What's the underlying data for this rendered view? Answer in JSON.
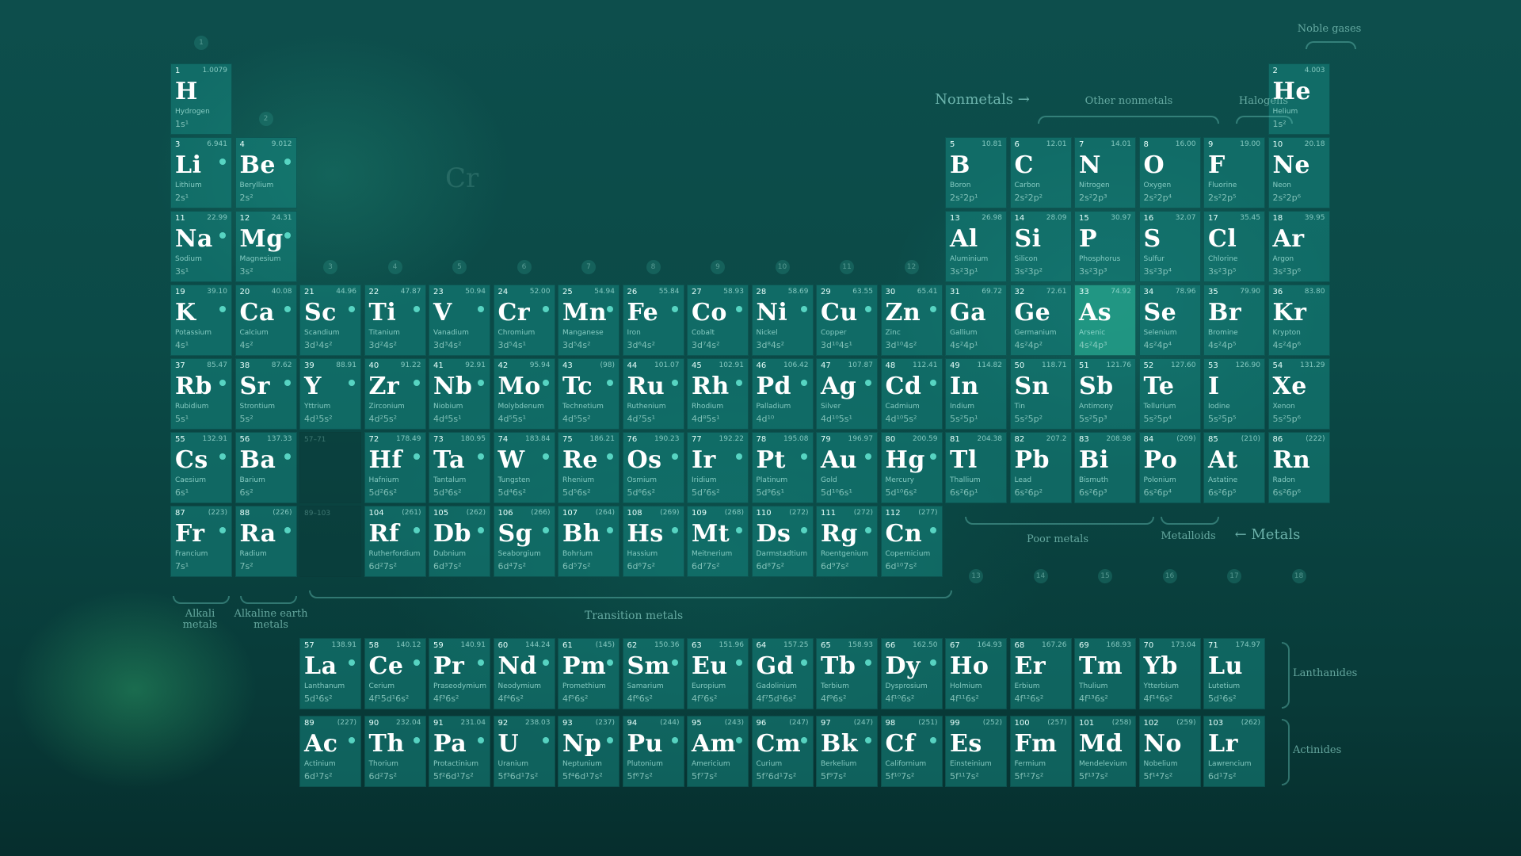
{
  "labels": {
    "noble_gases": "Noble gases",
    "nonmetals": "Nonmetals →",
    "other_nonmetals": "Other nonmetals",
    "halogens": "Halogens",
    "poor_metals": "Poor metals",
    "metalloids": "Metalloids",
    "metals": "← Metals",
    "alkali_metals": "Alkali\nmetals",
    "alkaline_earth_metals": "Alkaline earth\nmetals",
    "transition_metals": "Transition metals",
    "lanthanides": "Lanthanides",
    "actinides": "Actinides",
    "placeholder_57_71": "57–71",
    "placeholder_89_103": "89–103"
  },
  "group_numbers": [
    "1",
    "2",
    "3",
    "4",
    "5",
    "6",
    "7",
    "8",
    "9",
    "10",
    "11",
    "12",
    "13",
    "14",
    "15",
    "16",
    "17",
    "18"
  ],
  "elements": [
    {
      "n": "1",
      "m": "1.0079",
      "s": "H",
      "name": "Hydrogen",
      "c": "1s¹",
      "r": 1,
      "col": 1
    },
    {
      "n": "2",
      "m": "4.003",
      "s": "He",
      "name": "Helium",
      "c": "1s²",
      "r": 1,
      "col": 18
    },
    {
      "n": "3",
      "m": "6.941",
      "s": "Li",
      "name": "Lithium",
      "c": "2s¹",
      "r": 2,
      "col": 1
    },
    {
      "n": "4",
      "m": "9.012",
      "s": "Be",
      "name": "Beryllium",
      "c": "2s²",
      "r": 2,
      "col": 2
    },
    {
      "n": "5",
      "m": "10.81",
      "s": "B",
      "name": "Boron",
      "c": "2s²2p¹",
      "r": 2,
      "col": 13
    },
    {
      "n": "6",
      "m": "12.01",
      "s": "C",
      "name": "Carbon",
      "c": "2s²2p²",
      "r": 2,
      "col": 14
    },
    {
      "n": "7",
      "m": "14.01",
      "s": "N",
      "name": "Nitrogen",
      "c": "2s²2p³",
      "r": 2,
      "col": 15
    },
    {
      "n": "8",
      "m": "16.00",
      "s": "O",
      "name": "Oxygen",
      "c": "2s²2p⁴",
      "r": 2,
      "col": 16
    },
    {
      "n": "9",
      "m": "19.00",
      "s": "F",
      "name": "Fluorine",
      "c": "2s²2p⁵",
      "r": 2,
      "col": 17
    },
    {
      "n": "10",
      "m": "20.18",
      "s": "Ne",
      "name": "Neon",
      "c": "2s²2p⁶",
      "r": 2,
      "col": 18
    },
    {
      "n": "11",
      "m": "22.99",
      "s": "Na",
      "name": "Sodium",
      "c": "3s¹",
      "r": 3,
      "col": 1
    },
    {
      "n": "12",
      "m": "24.31",
      "s": "Mg",
      "name": "Magnesium",
      "c": "3s²",
      "r": 3,
      "col": 2
    },
    {
      "n": "13",
      "m": "26.98",
      "s": "Al",
      "name": "Aluminium",
      "c": "3s²3p¹",
      "r": 3,
      "col": 13
    },
    {
      "n": "14",
      "m": "28.09",
      "s": "Si",
      "name": "Silicon",
      "c": "3s²3p²",
      "r": 3,
      "col": 14
    },
    {
      "n": "15",
      "m": "30.97",
      "s": "P",
      "name": "Phosphorus",
      "c": "3s²3p³",
      "r": 3,
      "col": 15
    },
    {
      "n": "16",
      "m": "32.07",
      "s": "S",
      "name": "Sulfur",
      "c": "3s²3p⁴",
      "r": 3,
      "col": 16
    },
    {
      "n": "17",
      "m": "35.45",
      "s": "Cl",
      "name": "Chlorine",
      "c": "3s²3p⁵",
      "r": 3,
      "col": 17
    },
    {
      "n": "18",
      "m": "39.95",
      "s": "Ar",
      "name": "Argon",
      "c": "3s²3p⁶",
      "r": 3,
      "col": 18
    },
    {
      "n": "19",
      "m": "39.10",
      "s": "K",
      "name": "Potassium",
      "c": "4s¹",
      "r": 4,
      "col": 1
    },
    {
      "n": "20",
      "m": "40.08",
      "s": "Ca",
      "name": "Calcium",
      "c": "4s²",
      "r": 4,
      "col": 2
    },
    {
      "n": "21",
      "m": "44.96",
      "s": "Sc",
      "name": "Scandium",
      "c": "3d¹4s²",
      "r": 4,
      "col": 3
    },
    {
      "n": "22",
      "m": "47.87",
      "s": "Ti",
      "name": "Titanium",
      "c": "3d²4s²",
      "r": 4,
      "col": 4
    },
    {
      "n": "23",
      "m": "50.94",
      "s": "V",
      "name": "Vanadium",
      "c": "3d³4s²",
      "r": 4,
      "col": 5
    },
    {
      "n": "24",
      "m": "52.00",
      "s": "Cr",
      "name": "Chromium",
      "c": "3d⁵4s¹",
      "r": 4,
      "col": 6
    },
    {
      "n": "25",
      "m": "54.94",
      "s": "Mn",
      "name": "Manganese",
      "c": "3d⁵4s²",
      "r": 4,
      "col": 7
    },
    {
      "n": "26",
      "m": "55.84",
      "s": "Fe",
      "name": "Iron",
      "c": "3d⁶4s²",
      "r": 4,
      "col": 8
    },
    {
      "n": "27",
      "m": "58.93",
      "s": "Co",
      "name": "Cobalt",
      "c": "3d⁷4s²",
      "r": 4,
      "col": 9
    },
    {
      "n": "28",
      "m": "58.69",
      "s": "Ni",
      "name": "Nickel",
      "c": "3d⁸4s²",
      "r": 4,
      "col": 10
    },
    {
      "n": "29",
      "m": "63.55",
      "s": "Cu",
      "name": "Copper",
      "c": "3d¹⁰4s¹",
      "r": 4,
      "col": 11
    },
    {
      "n": "30",
      "m": "65.41",
      "s": "Zn",
      "name": "Zinc",
      "c": "3d¹⁰4s²",
      "r": 4,
      "col": 12
    },
    {
      "n": "31",
      "m": "69.72",
      "s": "Ga",
      "name": "Gallium",
      "c": "4s²4p¹",
      "r": 4,
      "col": 13
    },
    {
      "n": "32",
      "m": "72.61",
      "s": "Ge",
      "name": "Germanium",
      "c": "4s²4p²",
      "r": 4,
      "col": 14
    },
    {
      "n": "33",
      "m": "74.92",
      "s": "As",
      "name": "Arsenic",
      "c": "4s²4p³",
      "r": 4,
      "col": 15,
      "hi": true
    },
    {
      "n": "34",
      "m": "78.96",
      "s": "Se",
      "name": "Selenium",
      "c": "4s²4p⁴",
      "r": 4,
      "col": 16
    },
    {
      "n": "35",
      "m": "79.90",
      "s": "Br",
      "name": "Bromine",
      "c": "4s²4p⁵",
      "r": 4,
      "col": 17
    },
    {
      "n": "36",
      "m": "83.80",
      "s": "Kr",
      "name": "Krypton",
      "c": "4s²4p⁶",
      "r": 4,
      "col": 18
    },
    {
      "n": "37",
      "m": "85.47",
      "s": "Rb",
      "name": "Rubidium",
      "c": "5s¹",
      "r": 5,
      "col": 1
    },
    {
      "n": "38",
      "m": "87.62",
      "s": "Sr",
      "name": "Strontium",
      "c": "5s²",
      "r": 5,
      "col": 2
    },
    {
      "n": "39",
      "m": "88.91",
      "s": "Y",
      "name": "Yttrium",
      "c": "4d¹5s²",
      "r": 5,
      "col": 3
    },
    {
      "n": "40",
      "m": "91.22",
      "s": "Zr",
      "name": "Zirconium",
      "c": "4d²5s²",
      "r": 5,
      "col": 4
    },
    {
      "n": "41",
      "m": "92.91",
      "s": "Nb",
      "name": "Niobium",
      "c": "4d⁴5s¹",
      "r": 5,
      "col": 5
    },
    {
      "n": "42",
      "m": "95.94",
      "s": "Mo",
      "name": "Molybdenum",
      "c": "4d⁵5s¹",
      "r": 5,
      "col": 6
    },
    {
      "n": "43",
      "m": "(98)",
      "s": "Tc",
      "name": "Technetium",
      "c": "4d⁵5s²",
      "r": 5,
      "col": 7
    },
    {
      "n": "44",
      "m": "101.07",
      "s": "Ru",
      "name": "Ruthenium",
      "c": "4d⁷5s¹",
      "r": 5,
      "col": 8
    },
    {
      "n": "45",
      "m": "102.91",
      "s": "Rh",
      "name": "Rhodium",
      "c": "4d⁸5s¹",
      "r": 5,
      "col": 9
    },
    {
      "n": "46",
      "m": "106.42",
      "s": "Pd",
      "name": "Palladium",
      "c": "4d¹⁰",
      "r": 5,
      "col": 10
    },
    {
      "n": "47",
      "m": "107.87",
      "s": "Ag",
      "name": "Silver",
      "c": "4d¹⁰5s¹",
      "r": 5,
      "col": 11
    },
    {
      "n": "48",
      "m": "112.41",
      "s": "Cd",
      "name": "Cadmium",
      "c": "4d¹⁰5s²",
      "r": 5,
      "col": 12
    },
    {
      "n": "49",
      "m": "114.82",
      "s": "In",
      "name": "Indium",
      "c": "5s²5p¹",
      "r": 5,
      "col": 13
    },
    {
      "n": "50",
      "m": "118.71",
      "s": "Sn",
      "name": "Tin",
      "c": "5s²5p²",
      "r": 5,
      "col": 14
    },
    {
      "n": "51",
      "m": "121.76",
      "s": "Sb",
      "name": "Antimony",
      "c": "5s²5p³",
      "r": 5,
      "col": 15
    },
    {
      "n": "52",
      "m": "127.60",
      "s": "Te",
      "name": "Tellurium",
      "c": "5s²5p⁴",
      "r": 5,
      "col": 16
    },
    {
      "n": "53",
      "m": "126.90",
      "s": "I",
      "name": "Iodine",
      "c": "5s²5p⁵",
      "r": 5,
      "col": 17
    },
    {
      "n": "54",
      "m": "131.29",
      "s": "Xe",
      "name": "Xenon",
      "c": "5s²5p⁶",
      "r": 5,
      "col": 18
    },
    {
      "n": "55",
      "m": "132.91",
      "s": "Cs",
      "name": "Caesium",
      "c": "6s¹",
      "r": 6,
      "col": 1
    },
    {
      "n": "56",
      "m": "137.33",
      "s": "Ba",
      "name": "Barium",
      "c": "6s²",
      "r": 6,
      "col": 2
    },
    {
      "n": "72",
      "m": "178.49",
      "s": "Hf",
      "name": "Hafnium",
      "c": "5d²6s²",
      "r": 6,
      "col": 4
    },
    {
      "n": "73",
      "m": "180.95",
      "s": "Ta",
      "name": "Tantalum",
      "c": "5d³6s²",
      "r": 6,
      "col": 5
    },
    {
      "n": "74",
      "m": "183.84",
      "s": "W",
      "name": "Tungsten",
      "c": "5d⁴6s²",
      "r": 6,
      "col": 6
    },
    {
      "n": "75",
      "m": "186.21",
      "s": "Re",
      "name": "Rhenium",
      "c": "5d⁵6s²",
      "r": 6,
      "col": 7
    },
    {
      "n": "76",
      "m": "190.23",
      "s": "Os",
      "name": "Osmium",
      "c": "5d⁶6s²",
      "r": 6,
      "col": 8
    },
    {
      "n": "77",
      "m": "192.22",
      "s": "Ir",
      "name": "Iridium",
      "c": "5d⁷6s²",
      "r": 6,
      "col": 9
    },
    {
      "n": "78",
      "m": "195.08",
      "s": "Pt",
      "name": "Platinum",
      "c": "5d⁹6s¹",
      "r": 6,
      "col": 10
    },
    {
      "n": "79",
      "m": "196.97",
      "s": "Au",
      "name": "Gold",
      "c": "5d¹⁰6s¹",
      "r": 6,
      "col": 11
    },
    {
      "n": "80",
      "m": "200.59",
      "s": "Hg",
      "name": "Mercury",
      "c": "5d¹⁰6s²",
      "r": 6,
      "col": 12
    },
    {
      "n": "81",
      "m": "204.38",
      "s": "Tl",
      "name": "Thallium",
      "c": "6s²6p¹",
      "r": 6,
      "col": 13
    },
    {
      "n": "82",
      "m": "207.2",
      "s": "Pb",
      "name": "Lead",
      "c": "6s²6p²",
      "r": 6,
      "col": 14
    },
    {
      "n": "83",
      "m": "208.98",
      "s": "Bi",
      "name": "Bismuth",
      "c": "6s²6p³",
      "r": 6,
      "col": 15
    },
    {
      "n": "84",
      "m": "(209)",
      "s": "Po",
      "name": "Polonium",
      "c": "6s²6p⁴",
      "r": 6,
      "col": 16
    },
    {
      "n": "85",
      "m": "(210)",
      "s": "At",
      "name": "Astatine",
      "c": "6s²6p⁵",
      "r": 6,
      "col": 17
    },
    {
      "n": "86",
      "m": "(222)",
      "s": "Rn",
      "name": "Radon",
      "c": "6s²6p⁶",
      "r": 6,
      "col": 18
    },
    {
      "n": "87",
      "m": "(223)",
      "s": "Fr",
      "name": "Francium",
      "c": "7s¹",
      "r": 7,
      "col": 1
    },
    {
      "n": "88",
      "m": "(226)",
      "s": "Ra",
      "name": "Radium",
      "c": "7s²",
      "r": 7,
      "col": 2
    },
    {
      "n": "104",
      "m": "(261)",
      "s": "Rf",
      "name": "Rutherfordium",
      "c": "6d²7s²",
      "r": 7,
      "col": 4
    },
    {
      "n": "105",
      "m": "(262)",
      "s": "Db",
      "name": "Dubnium",
      "c": "6d³7s²",
      "r": 7,
      "col": 5
    },
    {
      "n": "106",
      "m": "(266)",
      "s": "Sg",
      "name": "Seaborgium",
      "c": "6d⁴7s²",
      "r": 7,
      "col": 6
    },
    {
      "n": "107",
      "m": "(264)",
      "s": "Bh",
      "name": "Bohrium",
      "c": "6d⁵7s²",
      "r": 7,
      "col": 7
    },
    {
      "n": "108",
      "m": "(269)",
      "s": "Hs",
      "name": "Hassium",
      "c": "6d⁶7s²",
      "r": 7,
      "col": 8
    },
    {
      "n": "109",
      "m": "(268)",
      "s": "Mt",
      "name": "Meitnerium",
      "c": "6d⁷7s²",
      "r": 7,
      "col": 9
    },
    {
      "n": "110",
      "m": "(272)",
      "s": "Ds",
      "name": "Darmstadtium",
      "c": "6d⁸7s²",
      "r": 7,
      "col": 10
    },
    {
      "n": "111",
      "m": "(272)",
      "s": "Rg",
      "name": "Roentgenium",
      "c": "6d⁹7s²",
      "r": 7,
      "col": 11
    },
    {
      "n": "112",
      "m": "(277)",
      "s": "Cn",
      "name": "Copernicium",
      "c": "6d¹⁰7s²",
      "r": 7,
      "col": 12
    },
    {
      "n": "57",
      "m": "138.91",
      "s": "La",
      "name": "Lanthanum",
      "c": "5d¹6s²",
      "r": 9,
      "col": 3
    },
    {
      "n": "58",
      "m": "140.12",
      "s": "Ce",
      "name": "Cerium",
      "c": "4f¹5d¹6s²",
      "r": 9,
      "col": 4
    },
    {
      "n": "59",
      "m": "140.91",
      "s": "Pr",
      "name": "Praseodymium",
      "c": "4f³6s²",
      "r": 9,
      "col": 5
    },
    {
      "n": "60",
      "m": "144.24",
      "s": "Nd",
      "name": "Neodymium",
      "c": "4f⁴6s²",
      "r": 9,
      "col": 6
    },
    {
      "n": "61",
      "m": "(145)",
      "s": "Pm",
      "name": "Promethium",
      "c": "4f⁵6s²",
      "r": 9,
      "col": 7
    },
    {
      "n": "62",
      "m": "150.36",
      "s": "Sm",
      "name": "Samarium",
      "c": "4f⁶6s²",
      "r": 9,
      "col": 8
    },
    {
      "n": "63",
      "m": "151.96",
      "s": "Eu",
      "name": "Europium",
      "c": "4f⁷6s²",
      "r": 9,
      "col": 9
    },
    {
      "n": "64",
      "m": "157.25",
      "s": "Gd",
      "name": "Gadolinium",
      "c": "4f⁷5d¹6s²",
      "r": 9,
      "col": 10
    },
    {
      "n": "65",
      "m": "158.93",
      "s": "Tb",
      "name": "Terbium",
      "c": "4f⁹6s²",
      "r": 9,
      "col": 11
    },
    {
      "n": "66",
      "m": "162.50",
      "s": "Dy",
      "name": "Dysprosium",
      "c": "4f¹⁰6s²",
      "r": 9,
      "col": 12
    },
    {
      "n": "67",
      "m": "164.93",
      "s": "Ho",
      "name": "Holmium",
      "c": "4f¹¹6s²",
      "r": 9,
      "col": 13
    },
    {
      "n": "68",
      "m": "167.26",
      "s": "Er",
      "name": "Erbium",
      "c": "4f¹²6s²",
      "r": 9,
      "col": 14
    },
    {
      "n": "69",
      "m": "168.93",
      "s": "Tm",
      "name": "Thulium",
      "c": "4f¹³6s²",
      "r": 9,
      "col": 15
    },
    {
      "n": "70",
      "m": "173.04",
      "s": "Yb",
      "name": "Ytterbium",
      "c": "4f¹⁴6s²",
      "r": 9,
      "col": 16
    },
    {
      "n": "71",
      "m": "174.97",
      "s": "Lu",
      "name": "Lutetium",
      "c": "5d¹6s²",
      "r": 9,
      "col": 17
    },
    {
      "n": "89",
      "m": "(227)",
      "s": "Ac",
      "name": "Actinium",
      "c": "6d¹7s²",
      "r": 10,
      "col": 3
    },
    {
      "n": "90",
      "m": "232.04",
      "s": "Th",
      "name": "Thorium",
      "c": "6d²7s²",
      "r": 10,
      "col": 4
    },
    {
      "n": "91",
      "m": "231.04",
      "s": "Pa",
      "name": "Protactinium",
      "c": "5f²6d¹7s²",
      "r": 10,
      "col": 5
    },
    {
      "n": "92",
      "m": "238.03",
      "s": "U",
      "name": "Uranium",
      "c": "5f³6d¹7s²",
      "r": 10,
      "col": 6
    },
    {
      "n": "93",
      "m": "(237)",
      "s": "Np",
      "name": "Neptunium",
      "c": "5f⁴6d¹7s²",
      "r": 10,
      "col": 7
    },
    {
      "n": "94",
      "m": "(244)",
      "s": "Pu",
      "name": "Plutonium",
      "c": "5f⁶7s²",
      "r": 10,
      "col": 8
    },
    {
      "n": "95",
      "m": "(243)",
      "s": "Am",
      "name": "Americium",
      "c": "5f⁷7s²",
      "r": 10,
      "col": 9
    },
    {
      "n": "96",
      "m": "(247)",
      "s": "Cm",
      "name": "Curium",
      "c": "5f⁷6d¹7s²",
      "r": 10,
      "col": 10
    },
    {
      "n": "97",
      "m": "(247)",
      "s": "Bk",
      "name": "Berkelium",
      "c": "5f⁹7s²",
      "r": 10,
      "col": 11
    },
    {
      "n": "98",
      "m": "(251)",
      "s": "Cf",
      "name": "Californium",
      "c": "5f¹⁰7s²",
      "r": 10,
      "col": 12
    },
    {
      "n": "99",
      "m": "(252)",
      "s": "Es",
      "name": "Einsteinium",
      "c": "5f¹¹7s²",
      "r": 10,
      "col": 13
    },
    {
      "n": "100",
      "m": "(257)",
      "s": "Fm",
      "name": "Fermium",
      "c": "5f¹²7s²",
      "r": 10,
      "col": 14
    },
    {
      "n": "101",
      "m": "(258)",
      "s": "Md",
      "name": "Mendelevium",
      "c": "5f¹³7s²",
      "r": 10,
      "col": 15
    },
    {
      "n": "102",
      "m": "(259)",
      "s": "No",
      "name": "Nobelium",
      "c": "5f¹⁴7s²",
      "r": 10,
      "col": 16
    },
    {
      "n": "103",
      "m": "(262)",
      "s": "Lr",
      "name": "Lawrencium",
      "c": "6d¹7s²",
      "r": 10,
      "col": 17
    }
  ]
}
